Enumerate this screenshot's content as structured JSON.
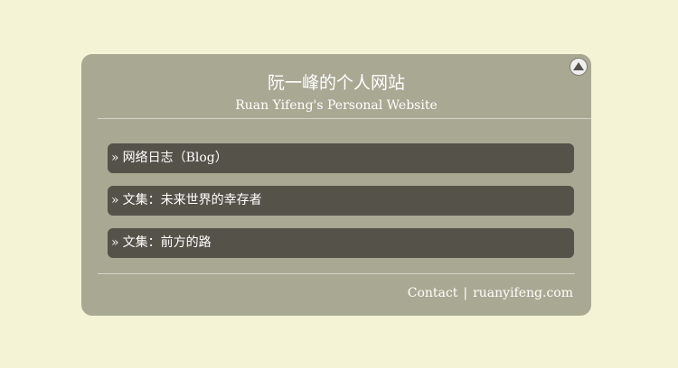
{
  "site": {
    "title": "阮一峰的个人网站",
    "subtitle": "Ruan Yifeng's Personal Website"
  },
  "nav": {
    "arrow": "»",
    "items": [
      {
        "label": "网络日志（Blog）"
      },
      {
        "label": "文集：未来世界的幸存者"
      },
      {
        "label": "文集：前方的路"
      }
    ]
  },
  "footer": {
    "contact": "Contact",
    "separator": "|",
    "domain": "ruanyifeng.com"
  },
  "icons": {
    "scroll_top": "triangle-up-icon"
  },
  "colors": {
    "page_background": "#f5f3d6",
    "card_background": "#a9a893",
    "item_background": "#555249",
    "text": "#ffffff"
  }
}
